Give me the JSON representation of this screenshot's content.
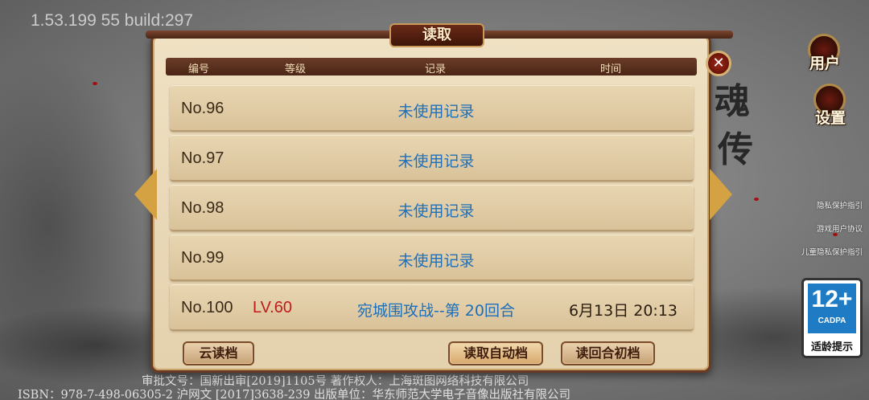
{
  "version_text": "1.53.199 55 build:297",
  "dialog": {
    "title": "读取",
    "columns": {
      "id": "编号",
      "level": "等级",
      "record": "记录",
      "time": "时间"
    },
    "slots": [
      {
        "id": "No.96",
        "level": "",
        "record": "未使用记录",
        "time": ""
      },
      {
        "id": "No.97",
        "level": "",
        "record": "未使用记录",
        "time": ""
      },
      {
        "id": "No.98",
        "level": "",
        "record": "未使用记录",
        "time": ""
      },
      {
        "id": "No.99",
        "level": "",
        "record": "未使用记录",
        "time": ""
      },
      {
        "id": "No.100",
        "level": "LV.60",
        "record": "宛城围攻战--第 20回合",
        "time": "6月13日 20:13"
      }
    ],
    "buttons": {
      "cloud_load": "云读档",
      "load_autosave": "读取自动档",
      "load_turn_start": "读回合初档"
    },
    "close_symbol": "✕"
  },
  "side_menu": {
    "user_label": "用户",
    "settings_label": "设置"
  },
  "links": {
    "privacy": "隐私保护指引",
    "user_agreement": "游戏用户协议",
    "child_privacy": "儿童隐私保护指引"
  },
  "age_rating": {
    "number": "12+",
    "org": "CADPA",
    "tip": "适龄提示"
  },
  "footer": {
    "line1": "审批文号：国新出审[2019]1105号    著作权人：上海斑图网络科技有限公司",
    "line2": "ISBN：978-7-498-06305-2  沪网文 [2017]3638-239   出版单位：华东师范大学电子音像出版社有限公司"
  },
  "colors": {
    "accent_gold": "#d4a243",
    "frame_brown": "#6c3a24",
    "record_blue": "#1f6fb8",
    "level_red": "#c01a1a"
  }
}
